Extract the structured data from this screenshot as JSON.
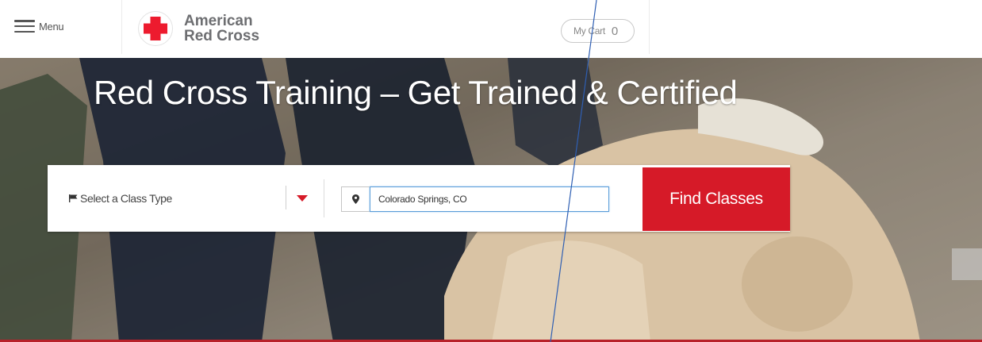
{
  "header": {
    "menu_label": "Menu",
    "logo_line1": "American",
    "logo_line2": "Red Cross",
    "cart_label": "My Cart",
    "cart_count": "0"
  },
  "hero": {
    "title": "Red Cross Training – Get Trained & Certified"
  },
  "search": {
    "class_type_label": "Select a Class Type",
    "location_value": "Colorado Springs, CO",
    "find_button_label": "Find Classes"
  },
  "colors": {
    "brand_red": "#d61a28",
    "logo_gray": "#6d6e71",
    "hero_accent_red": "#b8212a",
    "input_focus_blue": "#5b9dd9"
  },
  "icons": [
    "hamburger-icon",
    "red-cross-logo",
    "flag-icon",
    "caret-down-icon",
    "location-pin-icon"
  ]
}
